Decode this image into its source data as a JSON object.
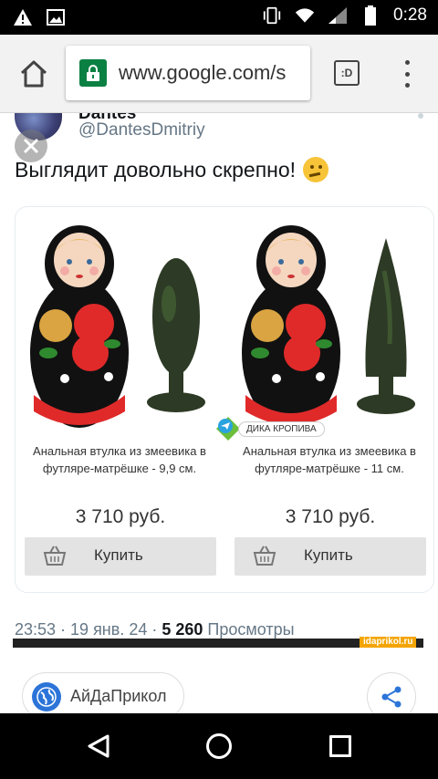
{
  "status_bar": {
    "time": "0:28",
    "icons": [
      "warning-icon",
      "image-icon",
      "vibrate-icon",
      "wifi-icon",
      "signal-icon",
      "battery-icon"
    ]
  },
  "browser": {
    "url": "www.google.com/s",
    "tabs_count_label": ":D",
    "icons": [
      "home-icon",
      "lock-icon",
      "tabs-icon",
      "more-vert-icon"
    ]
  },
  "tweet": {
    "display_name": "Dantes",
    "handle": "@DantesDmitriy",
    "text": "Выглядит довольно скрепно!",
    "emoji": "thinking-face-emoji",
    "timestamp": "23:53 · 19 янв. 24 · ",
    "views_count": "5 260",
    "views_label": " Просмотры",
    "products": [
      {
        "description": "Анальная втулка из змеевика в футляре-матрёшке - 9,9 см.",
        "price": "3 710 руб.",
        "button": "Купить"
      },
      {
        "description": "Анальная втулка из змеевика в футляре-матрёшке - 11 см.",
        "price": "3 710 руб.",
        "button": "Купить"
      }
    ],
    "overlay_badge": "ДИКА КРОПИВА",
    "watermark": "idaprikol.ru"
  },
  "footer": {
    "site_name": "АйДаПрикол",
    "share_icon": "share-icon"
  },
  "colors": {
    "status_bar": "#000000",
    "chrome_bar": "#f2f2f2",
    "lock_green": "#0b8043",
    "tweet_text": "#14171a",
    "meta_gray": "#657786",
    "button_gray": "#e3e3e3",
    "share_blue": "#2c74d8"
  }
}
